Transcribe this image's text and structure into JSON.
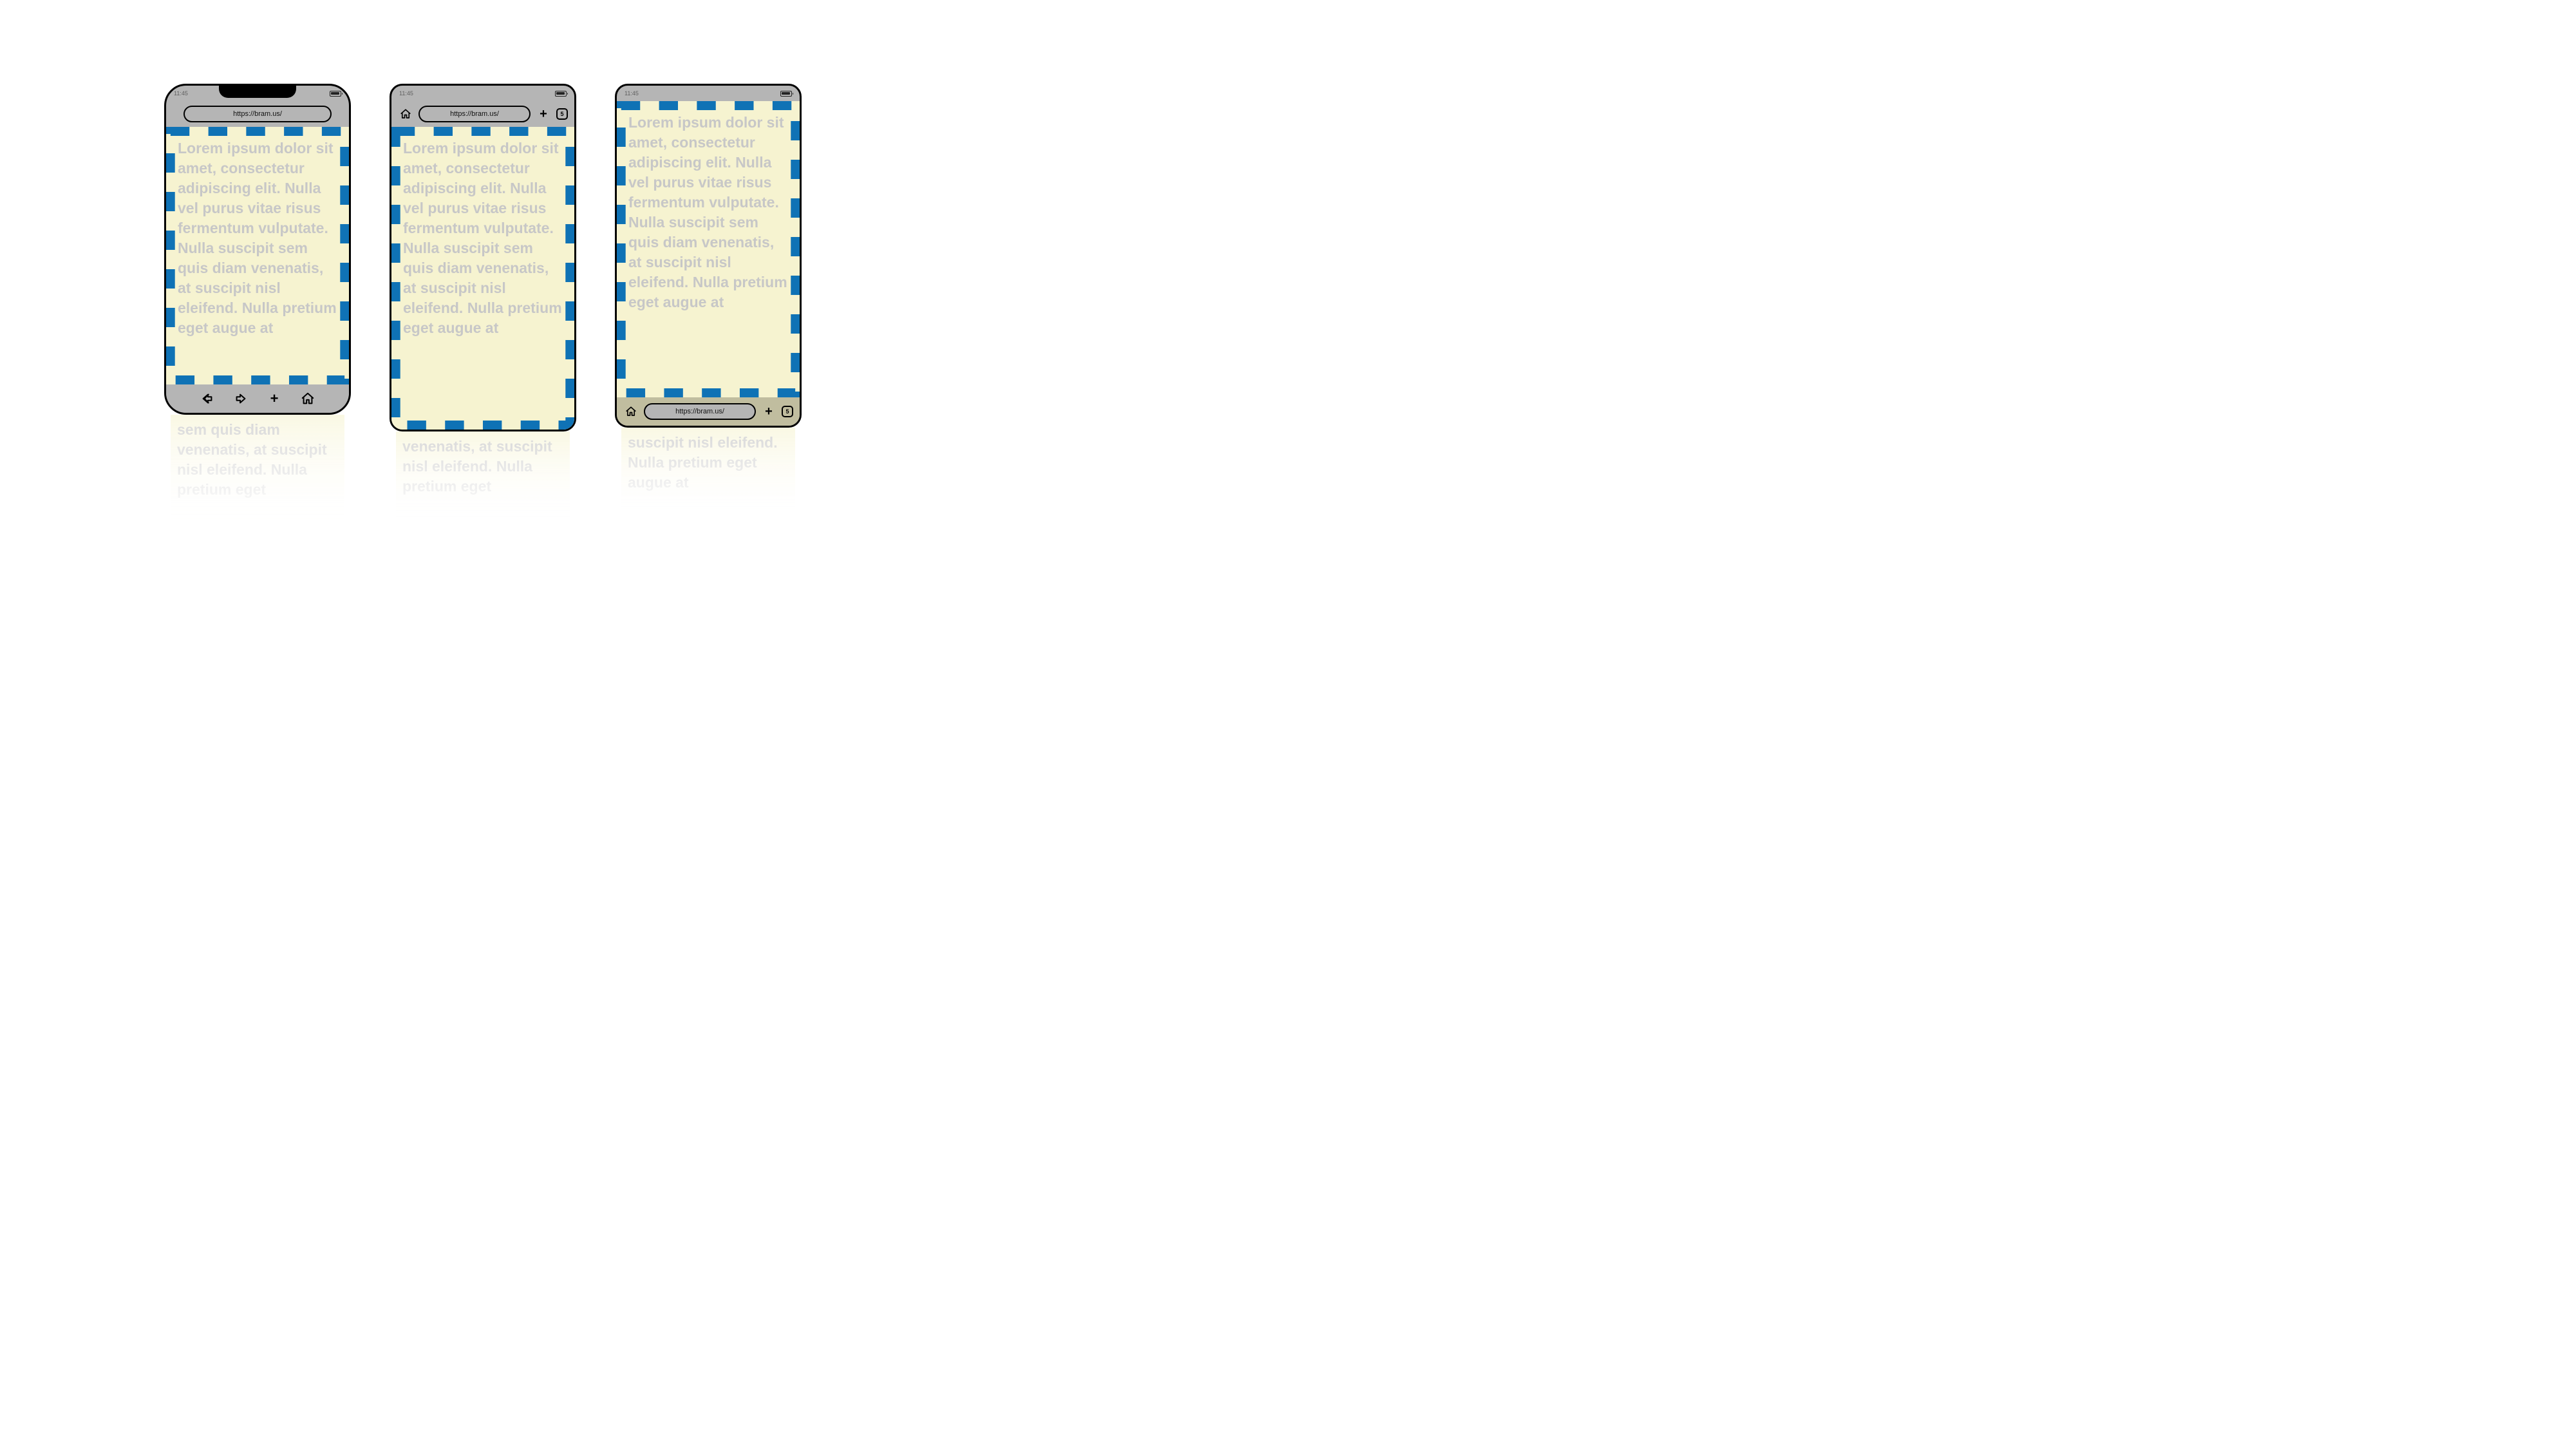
{
  "status": {
    "time": "11:45"
  },
  "url": "https://bram.us/",
  "tabs_count": "5",
  "lorem": "Lorem ipsum dolor sit amet, consectetur adipiscing elit. Nulla vel purus vitae risus fermentum vulputate. Nulla suscipit sem quis diam venenatis, at suscipit nisl eleifend. Nulla pretium eget augue at",
  "overflow_a": "sem quis diam venenatis, at suscipit nisl eleifend. Nulla pretium eget",
  "overflow_b": "venenatis, at suscipit nisl eleifend. Nulla pretium eget",
  "overflow_c": "suscipit nisl eleifend. Nulla pretium eget augue at",
  "icons": {
    "home": "home-icon",
    "back": "arrow-left-icon",
    "forward": "arrow-right-icon",
    "add": "plus-icon"
  }
}
